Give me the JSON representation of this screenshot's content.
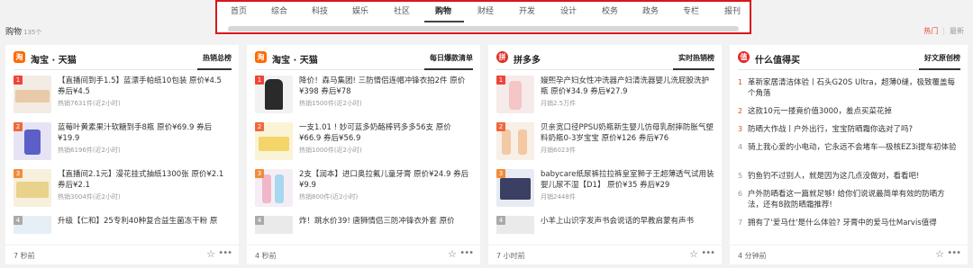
{
  "nav": {
    "items": [
      "首页",
      "综合",
      "科技",
      "娱乐",
      "社区",
      "购物",
      "财经",
      "开发",
      "设计",
      "校务",
      "政务",
      "专栏",
      "报刊"
    ],
    "active_index": 5,
    "highlight_color": "#d9171b"
  },
  "category": {
    "title": "购物",
    "count": "135个"
  },
  "sort": {
    "hot": "热门",
    "latest": "最新"
  },
  "cards": [
    {
      "brand": "淘宝 · 天猫",
      "logo_text": "淘",
      "board": "热销总榜",
      "time": "7 秒前",
      "items": [
        {
          "rank": "1",
          "title": "【直播间到手1.5】蓝漂手帕纸10包装 原价¥4.5 券后¥4.5",
          "meta": "热销7631件(近2小时)"
        },
        {
          "rank": "2",
          "title": "蓝莓叶黄素果汁软糖到手8瓶 原价¥69.9 券后¥19.9",
          "meta": "热销6196件(近2小时)"
        },
        {
          "rank": "3",
          "title": "【直播间2.1元】漫花挂式抽纸1300张 原价¥2.1 券后¥2.1",
          "meta": "热销3004件(近2小时)"
        },
        {
          "rank": "4",
          "title": "升级【仁和】25专利40种复合益生菌冻干粉 原",
          "meta": ""
        }
      ]
    },
    {
      "brand": "淘宝 · 天猫",
      "logo_text": "淘",
      "board": "每日爆款清单",
      "time": "4 秒前",
      "items": [
        {
          "rank": "1",
          "title": "降价！森马集团! 三防情侣连帽冲锋衣拍2件 原价¥398 券后¥78",
          "meta": "热销1500件(近2小时)"
        },
        {
          "rank": "2",
          "title": "一支1.01 ! 妙可蓝多奶酪棒钙多多56支 原价¥66.9 券后¥56.9",
          "meta": "热销1000件(近2小时)"
        },
        {
          "rank": "3",
          "title": "2支【润本】进口奥拉氟儿童牙膏 原价¥24.9 券后¥9.9",
          "meta": "热销800件(近2小时)"
        },
        {
          "rank": "4",
          "title": "炸！跳水价39! 唐狮情侣三防冲锋衣外套 原价",
          "meta": ""
        }
      ]
    },
    {
      "brand": "拼多多",
      "logo_text": "拼",
      "board": "实时热销榜",
      "time": "7 小时前",
      "items": [
        {
          "rank": "1",
          "title": "嫚熙孕产妇女性冲洗器产妇清洗器婴儿洗屁股洗护瓶 原价¥34.9 券后¥27.9",
          "meta": "月销2.5万件"
        },
        {
          "rank": "2",
          "title": "贝亲宽口径PPSU奶瓶新生婴儿仿母乳耐摔防胀气塑料奶瓶0-3岁宝宝 原价¥126 券后¥76",
          "meta": "月销6023件"
        },
        {
          "rank": "3",
          "title": "babycare纸尿裤拉拉裤皇室狮子王超薄透气试用装婴儿尿不湿【D1】 原价¥35 券后¥29",
          "meta": "月销2448件"
        },
        {
          "rank": "4",
          "title": "小羊上山识字发声书会说话的早教启蒙有声书",
          "meta": ""
        }
      ]
    },
    {
      "brand": "什么值得买",
      "logo_text": "值",
      "board": "好文原创榜",
      "time": "4 分钟前",
      "items": [
        {
          "rank": "1",
          "title": "革新家居清洁体验丨石头G20S Ultra，超薄0缝，极致覆盖每个角落"
        },
        {
          "rank": "2",
          "title": "这款10元一搂竟价值3000，羞点买菜花掉"
        },
        {
          "rank": "3",
          "title": "防晒大作战丨户外出行，宝宝防晒霜你选对了吗?"
        },
        {
          "rank": "4",
          "title": "骑上我心爱的小电动，它永远不会堵车—极核EZ3i提车初体验"
        },
        {
          "rank": "5",
          "title": "钓鱼钓不过别人，就是因为这几点没做对，看看吧!"
        },
        {
          "rank": "6",
          "title": "户外防晒看这一篇就足够! 给你们说说最简单有效的防晒方法，还有8款防晒霜推荐!"
        },
        {
          "rank": "7",
          "title": "拥有了'爱马仕'是什么体验? 牙膏中的爱马仕Marvis值得"
        }
      ]
    }
  ]
}
